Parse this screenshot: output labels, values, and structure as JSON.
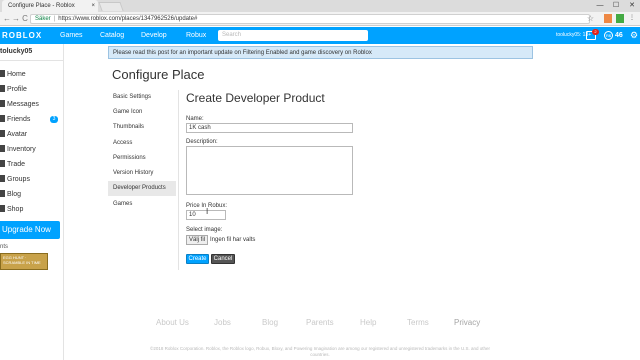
{
  "browser": {
    "tab_title": "Configure Place - Roblox",
    "tab_close": "×",
    "win_min": "—",
    "win_max": "☐",
    "win_close": "✕",
    "back": "←",
    "forward": "→",
    "reload": "C",
    "secure_label": "Säker",
    "url": "https://www.roblox.com/places/1347962526/update#",
    "star": "☆"
  },
  "topbar": {
    "logo": "ROBLOX",
    "nav": [
      "Games",
      "Catalog",
      "Develop",
      "Robux"
    ],
    "search_placeholder": "Search",
    "user_label": "toolucky05: 13+",
    "notifications": "2",
    "robux_icon": "R$",
    "robux": "46",
    "gear": "⚙"
  },
  "sidebar": {
    "username": "tolucky05",
    "items": [
      {
        "label": "Home"
      },
      {
        "label": "Profile"
      },
      {
        "label": "Messages"
      },
      {
        "label": "Friends",
        "badge": "3"
      },
      {
        "label": "Avatar"
      },
      {
        "label": "Inventory"
      },
      {
        "label": "Trade"
      },
      {
        "label": "Groups"
      },
      {
        "label": "Blog"
      },
      {
        "label": "Shop"
      }
    ],
    "upgrade": "Upgrade Now",
    "events_label": "nts",
    "events_banner": "EGG HUNT · SCRAMBLE IN TIME"
  },
  "announcement": "Please read this post for an important update on Filtering Enabled and game discovery on Roblox",
  "page": {
    "title": "Configure Place",
    "nav": [
      "Basic Settings",
      "Game Icon",
      "Thumbnails",
      "Access",
      "Permissions",
      "Version History",
      "Developer Products",
      "Games"
    ],
    "active_nav": "Developer Products"
  },
  "form": {
    "title": "Create Developer Product",
    "name_label": "Name:",
    "name_value": "1K cash",
    "description_label": "Description:",
    "price_label": "Price In Robux:",
    "price_value": "10",
    "image_label": "Select image:",
    "file_button": "Välj fil",
    "file_status": "Ingen fil har valts",
    "create": "Create",
    "cancel": "Cancel"
  },
  "footer": {
    "links": [
      "About Us",
      "Jobs",
      "Blog",
      "Parents",
      "Help",
      "Terms",
      "Privacy"
    ],
    "copyright": "©2018 Roblox Corporation. Roblox, the Roblox logo, Robux, Bloxy, and Powering Imagination are among our registered and unregistered trademarks in the U.S. and other countries."
  }
}
